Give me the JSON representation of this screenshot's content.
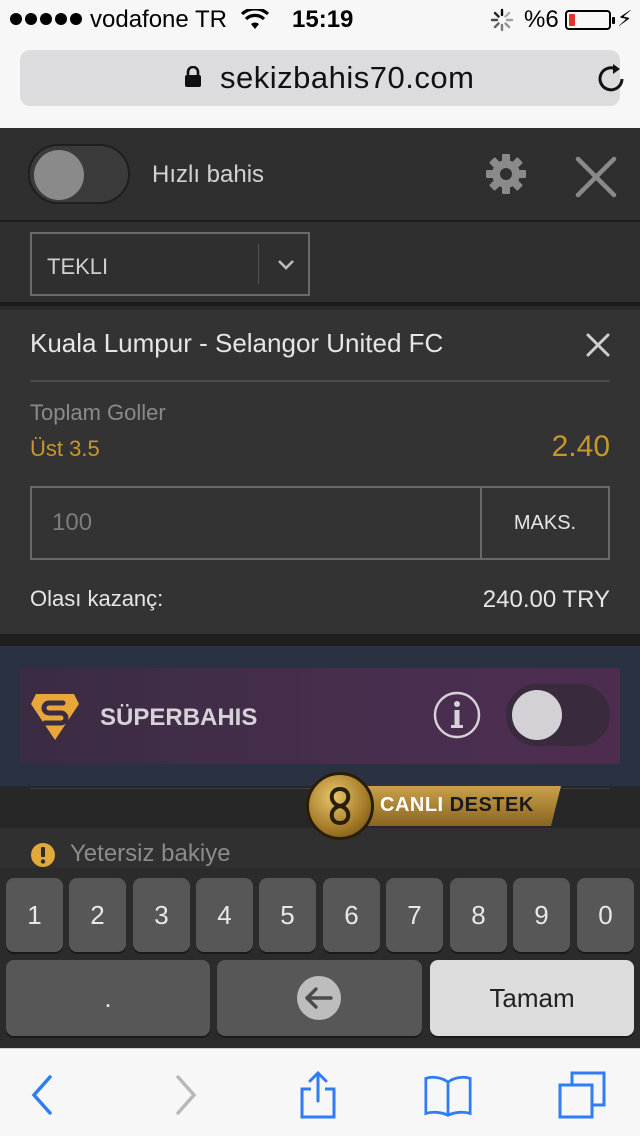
{
  "status_bar": {
    "carrier": "vodafone TR",
    "time": "15:19",
    "battery_percent": "%6"
  },
  "browser": {
    "url": "sekizbahis70.com"
  },
  "betslip": {
    "quick_bet_label": "Hızlı bahis",
    "quick_bet_enabled": false,
    "bet_type": "TEKLI",
    "match": "Kuala Lumpur - Selangor United FC",
    "market": "Toplam Goller",
    "selection": "Üst 3.5",
    "odds": "2.40",
    "stake_placeholder": "100",
    "max_button": "MAKS.",
    "potential_win_label": "Olası kazanç:",
    "potential_win_value": "240.00 TRY"
  },
  "superbet": {
    "label": "SÜPERBAHIS",
    "enabled": false
  },
  "live_support": {
    "label_part1": "CANLI",
    "label_part2": "DESTEK"
  },
  "notice": {
    "text": "Yetersiz bakiye"
  },
  "keyboard": {
    "digits": [
      "1",
      "2",
      "3",
      "4",
      "5",
      "6",
      "7",
      "8",
      "9",
      "0"
    ],
    "dot": ".",
    "done": "Tamam"
  },
  "colors": {
    "accent_gold": "#c8962d",
    "panel": "#333333",
    "superbet_bg": "#4a2e50",
    "ios_blue": "#2f7cf6"
  },
  "icons": {
    "settings": "gear-icon",
    "close": "close-icon",
    "info": "info-icon",
    "warning": "warning-icon",
    "back": "back-icon",
    "forward": "forward-icon",
    "share": "share-icon",
    "bookmarks": "bookmarks-icon",
    "tabs": "tabs-icon"
  }
}
